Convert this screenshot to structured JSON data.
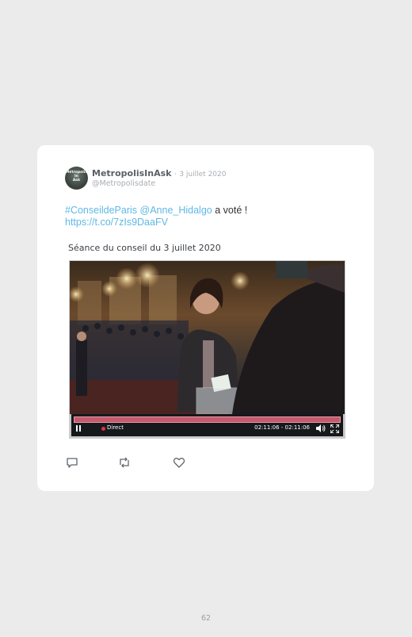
{
  "tweet": {
    "avatar_text": "Métropolis\nIn\nAsk",
    "author_name": "MetropolisInAsk",
    "separator": "·",
    "date": "3 juillet 2020",
    "handle": "@Metropolisdate",
    "hashtag": "#ConseildeParis",
    "mention": "@Anne_Hidalgo",
    "text": " a voté !",
    "url": "https://t.co/7zIs9DaaFV"
  },
  "video": {
    "title": "Séance du conseil du 3 juillet 2020",
    "live_label": "Direct",
    "time": "02:11:06 - 02:11:06",
    "progress_percent": 100,
    "accent_color": "#c6596c",
    "icons": [
      "pause-icon",
      "live-dot-icon",
      "volume-icon",
      "fullscreen-icon"
    ]
  },
  "actions": {
    "icons": [
      "reply-icon",
      "retweet-icon",
      "like-icon"
    ]
  },
  "page": {
    "number": "62"
  }
}
